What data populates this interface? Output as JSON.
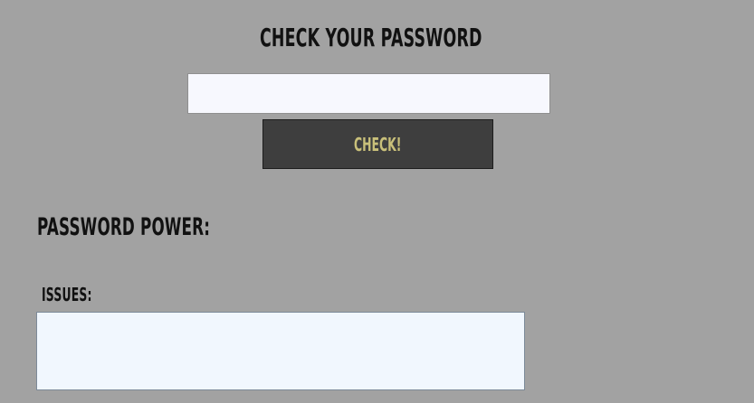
{
  "header": {
    "title": "CHECK YOUR PASSWORD"
  },
  "password_input": {
    "value": "",
    "placeholder": ""
  },
  "check_button": {
    "label": "CHECK!"
  },
  "power": {
    "label": "PASSWORD POWER:"
  },
  "issues": {
    "label": "ISSUES:",
    "content": ""
  },
  "colors": {
    "background": "#a2a2a2",
    "input_background": "#f7f8fe",
    "button_background": "#3e3e3e",
    "button_text": "#c9c07a",
    "issues_background": "#f1f7fe",
    "text": "#111111"
  }
}
